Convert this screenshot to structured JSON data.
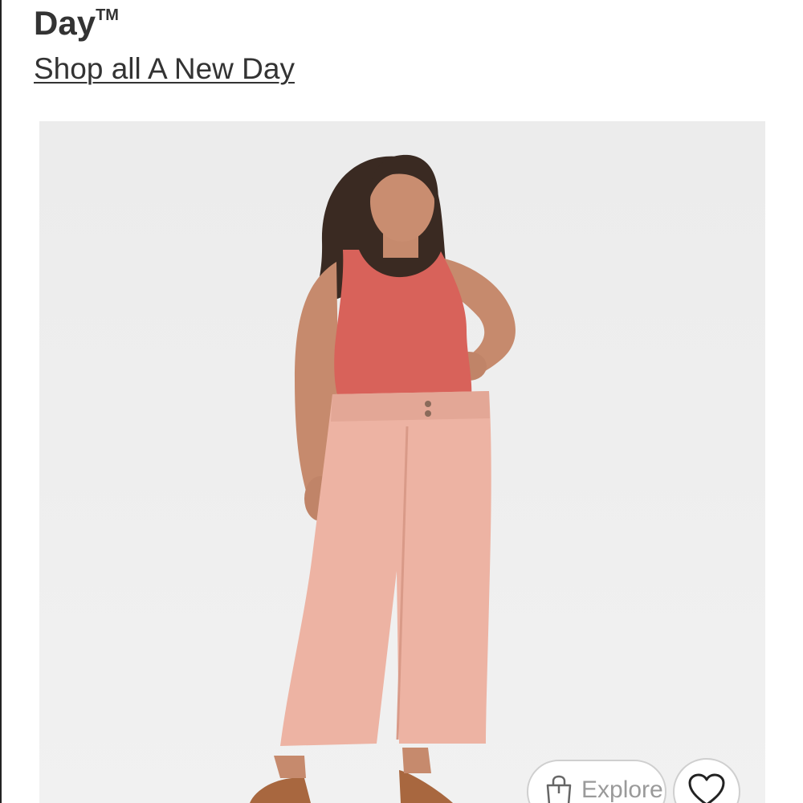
{
  "brand": {
    "title": "Day",
    "trademark": "TM"
  },
  "shop_link": {
    "label": "Shop all A New Day"
  },
  "product_image": {
    "alt": "A New Day wide leg pants"
  },
  "actions": {
    "explore_label": "Explore",
    "explore_icon": "shopping-bag-icon",
    "favorite_icon": "heart-icon"
  },
  "colors": {
    "text": "#333333",
    "image_background": "#eeeeee",
    "tank_top": "#d8625a",
    "pants": "#edb3a3",
    "shoes": "#a8673f",
    "pill_border": "#cfcfcf"
  }
}
